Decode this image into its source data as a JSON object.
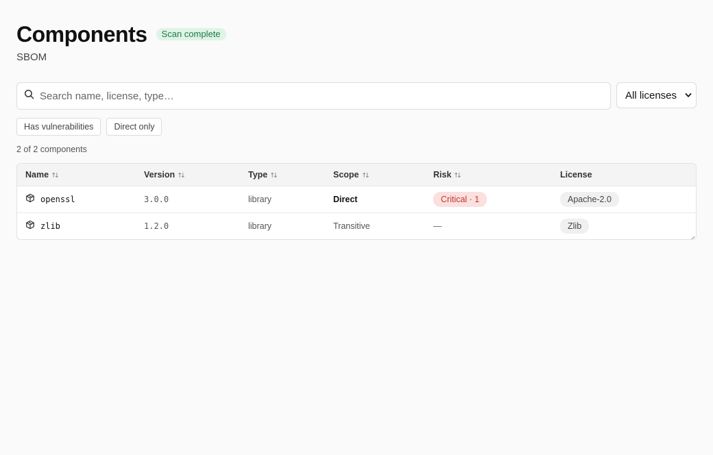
{
  "header": {
    "title": "Components",
    "status_badge": "Scan complete",
    "subtitle": "SBOM"
  },
  "search": {
    "placeholder": "Search name, license, type…",
    "value": ""
  },
  "license_filter": {
    "selected": "All licenses"
  },
  "filter_chips": [
    "Has vulnerabilities",
    "Direct only"
  ],
  "result_count": "2 of 2 components",
  "table": {
    "columns": [
      "Name",
      "Version",
      "Type",
      "Scope",
      "Risk",
      "License"
    ],
    "rows": [
      {
        "name": "openssl",
        "version": "3.0.0",
        "type": "library",
        "scope": "Direct",
        "risk": "Critical · 1",
        "license": "Apache-2.0"
      },
      {
        "name": "zlib",
        "version": "1.2.0",
        "type": "library",
        "scope": "Transitive",
        "risk": "—",
        "license": "Zlib"
      }
    ]
  },
  "colors": {
    "accent_success_bg": "#dff3e7",
    "accent_success_text": "#1f7a44",
    "critical_bg": "#fbe0e0",
    "critical_text": "#c0392b"
  },
  "icons": {
    "search": "search-icon",
    "sort": "sort-icon",
    "package": "package-icon",
    "select_arrow": "chevron-down-icon"
  }
}
